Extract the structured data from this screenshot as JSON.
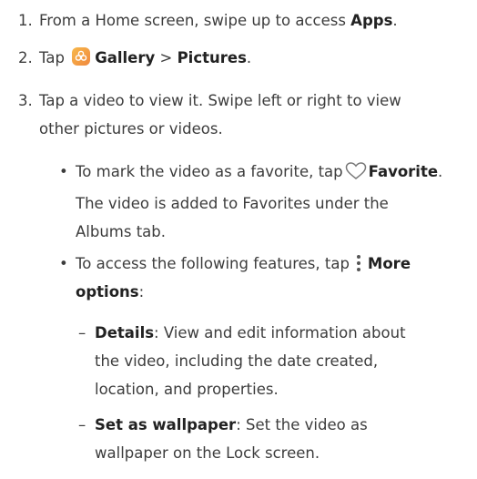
{
  "steps": [
    {
      "num": "1.",
      "pre": "From a Home screen, swipe up to access ",
      "bold": "Apps",
      "post": "."
    },
    {
      "num": "2.",
      "pre": "Tap ",
      "bold1": "Gallery",
      "sep": " > ",
      "bold2": "Pictures",
      "post": ".",
      "icon": "gallery-icon"
    },
    {
      "num": "3.",
      "line1": "Tap a video to view it. Swipe left or right to view",
      "line2": "other pictures or videos."
    }
  ],
  "bullets": [
    {
      "pre": "To mark the video as a favorite, tap",
      "bold": "Favorite",
      "post": ".",
      "icon": "heart-icon",
      "line2": "The video is added to Favorites under the",
      "line3": "Albums tab."
    },
    {
      "pre": "To access the following features, tap",
      "bold": "More",
      "icon": "more-options-icon",
      "line2_bold": "options",
      "line2_post": ":"
    }
  ],
  "sub_items": [
    {
      "bold": "Details",
      "post": ": View and edit information about",
      "line2": "the video, including the date created,",
      "line3": "location, and properties."
    },
    {
      "bold": "Set as wallpaper",
      "post": ": Set the video as",
      "line2": "wallpaper on the Lock screen."
    }
  ],
  "bullet_char": "•",
  "dash_char": "–"
}
